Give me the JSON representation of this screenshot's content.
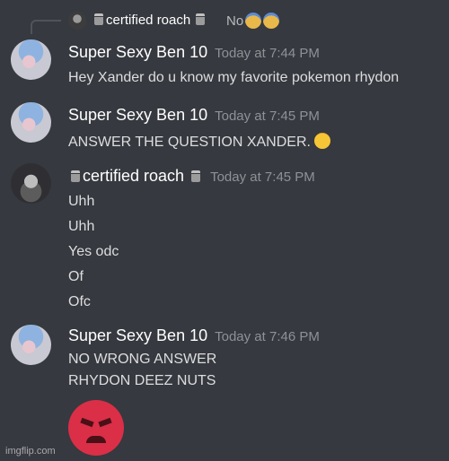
{
  "reply": {
    "username": "certified roach",
    "preview": "No"
  },
  "messages": [
    {
      "username": "Super Sexy Ben 10",
      "timestamp": "Today at 7:44 PM",
      "lines": [
        "Hey Xander do u know my favorite pokemon rhydon"
      ]
    },
    {
      "username": "Super Sexy Ben 10",
      "timestamp": "Today at 7:45 PM",
      "lines": [
        "ANSWER THE QUESTION XANDER."
      ]
    },
    {
      "username": "certified roach",
      "timestamp": "Today at 7:45 PM",
      "lines": [
        "Uhh",
        "Uhh",
        "Yes odc",
        "Of",
        "Ofc"
      ]
    },
    {
      "username": "Super Sexy Ben 10",
      "timestamp": "Today at 7:46 PM",
      "lines": [
        "NO WRONG ANSWER",
        "RHYDON DEEZ NUTS"
      ]
    }
  ],
  "watermark": "imgflip.com",
  "colors": {
    "background": "#36393f",
    "username": "#ffffff",
    "timestamp": "#8e9297",
    "text": "#dcddde",
    "angry_emoji": "#da2f47"
  }
}
